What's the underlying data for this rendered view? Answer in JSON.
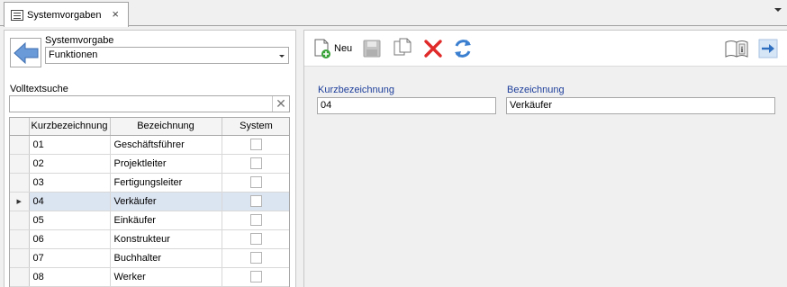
{
  "tab": {
    "title": "Systemvorgaben",
    "close": "×"
  },
  "left": {
    "systemvorgabe_label": "Systemvorgabe",
    "systemvorgabe_value": "Funktionen",
    "search_label": "Volltextsuche",
    "search_value": "",
    "search_clear": "✕",
    "grid": {
      "columns": [
        "Kurzbezeichnung",
        "Bezeichnung",
        "System"
      ],
      "rows": [
        {
          "kurz": "01",
          "bez": "Geschäftsführer",
          "system": false
        },
        {
          "kurz": "02",
          "bez": "Projektleiter",
          "system": false
        },
        {
          "kurz": "03",
          "bez": "Fertigungsleiter",
          "system": false
        },
        {
          "kurz": "04",
          "bez": "Verkäufer",
          "system": false,
          "selected": true
        },
        {
          "kurz": "05",
          "bez": "Einkäufer",
          "system": false
        },
        {
          "kurz": "06",
          "bez": "Konstrukteur",
          "system": false
        },
        {
          "kurz": "07",
          "bez": "Buchhalter",
          "system": false
        },
        {
          "kurz": "08",
          "bez": "Werker",
          "system": false
        }
      ],
      "current_row_marker": "▶"
    }
  },
  "toolbar": {
    "new_label": "Neu",
    "icons": [
      "new-document-icon",
      "save-icon",
      "copy-icon",
      "delete-icon",
      "refresh-icon",
      "info-book-icon",
      "exit-arrow-icon"
    ]
  },
  "detail": {
    "kurz_label": "Kurzbezeichnung",
    "kurz_value": "04",
    "bez_label": "Bezeichnung",
    "bez_value": "Verkäufer"
  },
  "colors": {
    "accent_blue": "#1e3f9b",
    "selection": "#dbe4f1",
    "delete_red": "#e02a2a",
    "refresh_blue": "#3a7fd0"
  }
}
